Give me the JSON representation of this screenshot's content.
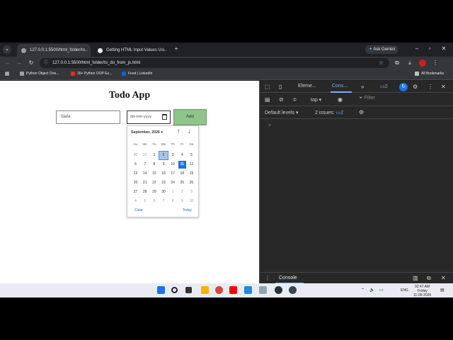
{
  "browser": {
    "tabs": [
      {
        "label": "127.0.0.1:5500/html_folder/to..",
        "active": true
      },
      {
        "label": "Getting HTML Input Values Usi..",
        "active": false
      }
    ],
    "ask_gemini": "Ask Gemini",
    "url": "127.0.0.1:5500/html_folder/to_do_from_js.html",
    "bookmarks": [
      "Python Object Orie...",
      "30+ Python OOP Ex...",
      "Feed | LinkedIn"
    ],
    "all_bookmarks": "All Bookmarks"
  },
  "page": {
    "title": "Todo App",
    "task_input_value": "fdafa",
    "date_input_value": "dd-mm-yyyy",
    "add_button": "Add"
  },
  "date_picker": {
    "month_label": "September, 2026",
    "weekdays": [
      "Su",
      "Mo",
      "Tu",
      "We",
      "Th",
      "Fr",
      "Sa"
    ],
    "days": [
      {
        "d": "30",
        "dim": true
      },
      {
        "d": "31",
        "dim": true
      },
      {
        "d": "1"
      },
      {
        "d": "2",
        "hover": true
      },
      {
        "d": "3"
      },
      {
        "d": "4"
      },
      {
        "d": "5"
      },
      {
        "d": "6"
      },
      {
        "d": "7"
      },
      {
        "d": "8"
      },
      {
        "d": "9"
      },
      {
        "d": "10"
      },
      {
        "d": "11",
        "selected": true
      },
      {
        "d": "12"
      },
      {
        "d": "13"
      },
      {
        "d": "14"
      },
      {
        "d": "15"
      },
      {
        "d": "16"
      },
      {
        "d": "17"
      },
      {
        "d": "18"
      },
      {
        "d": "19"
      },
      {
        "d": "20"
      },
      {
        "d": "21"
      },
      {
        "d": "22"
      },
      {
        "d": "23"
      },
      {
        "d": "24"
      },
      {
        "d": "25"
      },
      {
        "d": "26"
      },
      {
        "d": "27"
      },
      {
        "d": "28"
      },
      {
        "d": "29"
      },
      {
        "d": "30"
      },
      {
        "d": "1",
        "dim": true
      },
      {
        "d": "2",
        "dim": true
      },
      {
        "d": "3",
        "dim": true
      },
      {
        "d": "4",
        "dim": true
      },
      {
        "d": "5",
        "dim": true
      },
      {
        "d": "6",
        "dim": true
      },
      {
        "d": "7",
        "dim": true
      },
      {
        "d": "8",
        "dim": true
      },
      {
        "d": "9",
        "dim": true
      },
      {
        "d": "10",
        "dim": true
      }
    ],
    "clear": "Clear",
    "today": "Today"
  },
  "devtools": {
    "tabs": [
      "Eleme...",
      "Cons..."
    ],
    "issues_badge": "2",
    "context": "top",
    "filter_placeholder": "Filter",
    "default_levels": "Default levels",
    "issues_label": "2 issues:",
    "issues_count": "2",
    "prompt": ">",
    "drawer_tab": "Console"
  },
  "taskbar": {
    "time": "02:47 AM",
    "day": "Friday",
    "date": "11-09-2026",
    "lang": "ENG"
  }
}
